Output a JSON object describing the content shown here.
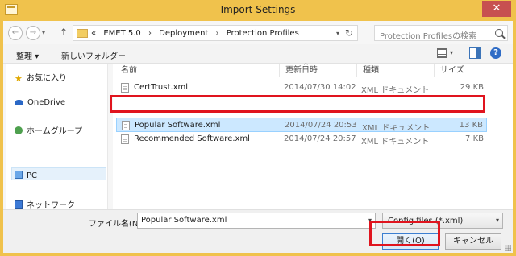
{
  "window": {
    "title": "Import Settings",
    "close_glyph": "✕"
  },
  "nav": {
    "back_glyph": "←",
    "forward_glyph": "→",
    "dropdown_glyph": "▾",
    "up_glyph": "↑",
    "breadcrumb_prefix": "«",
    "breadcrumb": [
      "EMET 5.0",
      "Deployment",
      "Protection Profiles"
    ],
    "separator": "›",
    "refresh_glyph": "↻",
    "search_placeholder": "Protection Profilesの検索"
  },
  "toolbar": {
    "organize_label": "整理 ▾",
    "new_folder_label": "新しいフォルダー",
    "view_dropdown_glyph": "▾",
    "help_glyph": "?"
  },
  "sidebar": {
    "items": [
      {
        "label": "お気に入り",
        "icon": "star-icon"
      },
      {
        "label": "OneDrive",
        "icon": "cloud-icon"
      },
      {
        "label": "ホームグループ",
        "icon": "homegroup-icon"
      },
      {
        "label": "PC",
        "icon": "computer-icon"
      },
      {
        "label": "ネットワーク",
        "icon": "network-icon"
      }
    ],
    "star_glyph": "★"
  },
  "filelist": {
    "columns": {
      "name": "名前",
      "date": "更新日時",
      "type": "種類",
      "size": "サイズ"
    },
    "sort_glyph": "^",
    "rows": [
      {
        "name": "CertTrust.xml",
        "date": "2014/07/30 14:02",
        "type": "XML ドキュメント",
        "size": "29 KB",
        "selected": false
      },
      {
        "name": "Popular Software.xml",
        "date": "2014/07/24 20:53",
        "type": "XML ドキュメント",
        "size": "13 KB",
        "selected": true
      },
      {
        "name": "Recommended Software.xml",
        "date": "2014/07/24 20:57",
        "type": "XML ドキュメント",
        "size": "7 KB",
        "selected": false
      }
    ]
  },
  "bottom": {
    "filename_label": "ファイル名(N):",
    "filename_value": "Popular Software.xml",
    "filter_value": "Config files (*.xml)",
    "dropdown_glyph": "▾",
    "open_label": "開く(O)",
    "cancel_label": "キャンセル"
  },
  "colors": {
    "frame": "#f0c24c",
    "selection": "#cce8ff",
    "highlight_box": "#e0141e",
    "close_button": "#c75050"
  }
}
